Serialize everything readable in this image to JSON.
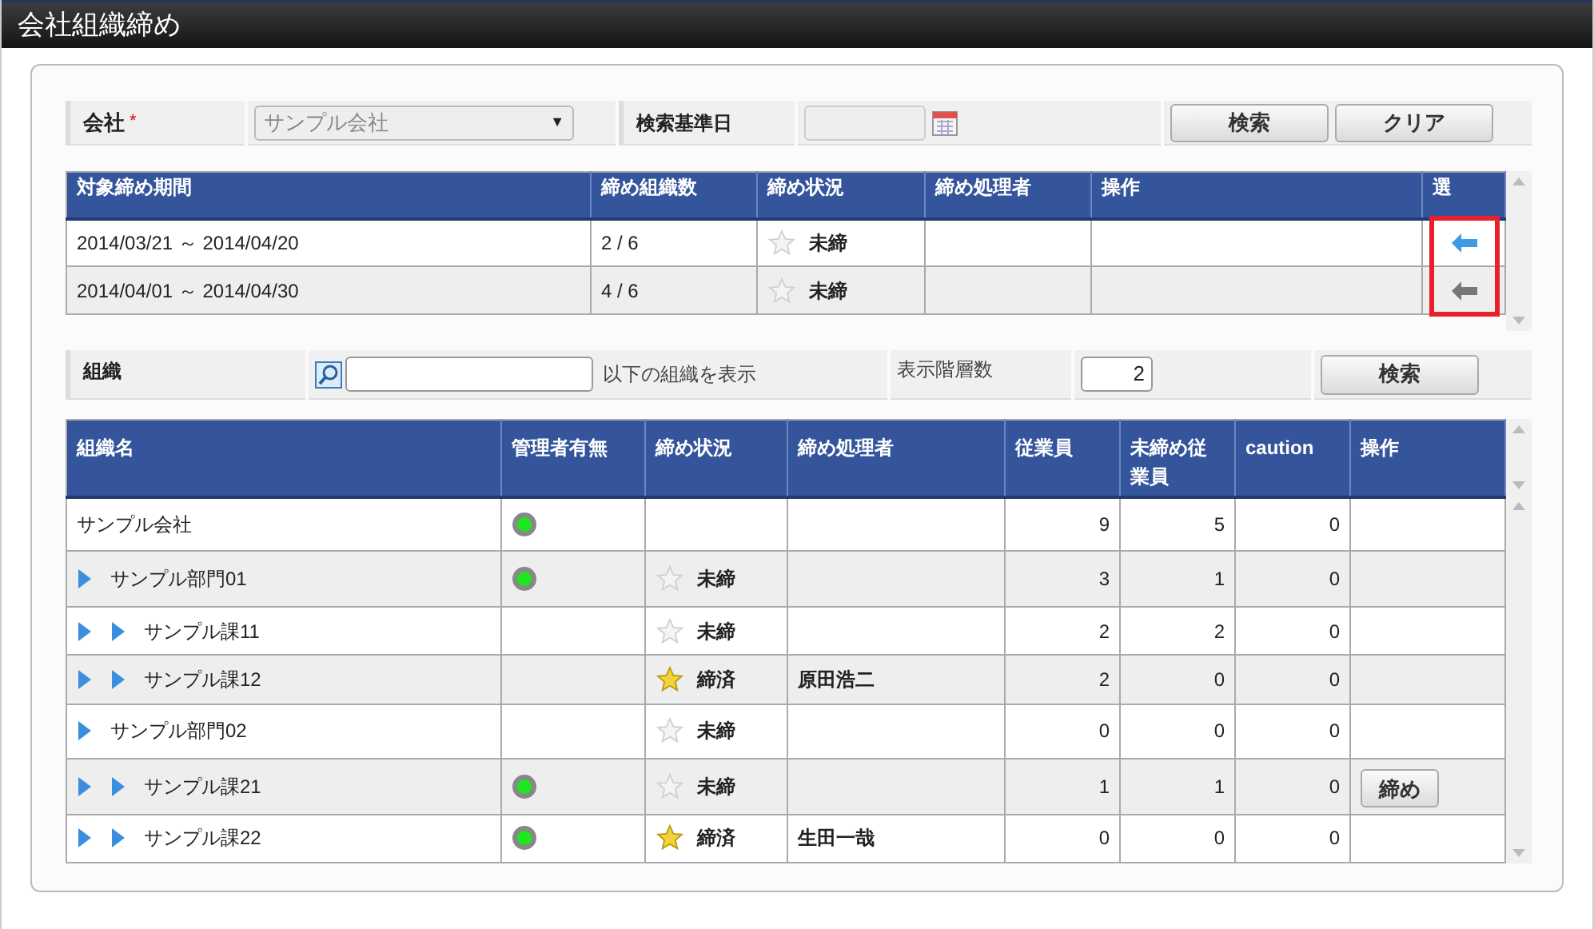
{
  "window": {
    "title": "会社組織締め"
  },
  "filter": {
    "company_label": "会社",
    "required_mark": "*",
    "company_value": "サンプル会社",
    "dropdown_glyph": "▼",
    "date_label": "検索基準日",
    "buttons": [
      "検索",
      "クリア"
    ]
  },
  "periods": {
    "columns": [
      "対象締め期間",
      "締め組織数",
      "締め状況",
      "締め処理者",
      "操作",
      "選"
    ],
    "rows": [
      {
        "period": "2014/03/21 ～ 2014/04/20",
        "count": "2 / 6",
        "closed": false,
        "status": "未締",
        "selected": true
      },
      {
        "period": "2014/04/01 ～ 2014/04/30",
        "count": "4 / 6",
        "closed": false,
        "status": "未締",
        "selected": false
      }
    ]
  },
  "org_filter": {
    "label": "組織",
    "suffix": "以下の組織を表示",
    "levels_label": "表示階層数",
    "levels_value": "2",
    "button": "検索"
  },
  "orgs": {
    "columns": [
      "組織名",
      "管理者有無",
      "締め状況",
      "締め処理者",
      "従業員",
      "未締め従業員",
      "caution",
      "操作"
    ],
    "rows": [
      {
        "name": "サンプル会社",
        "manager": true,
        "employees": "9",
        "unclosed": "5",
        "caution": "0",
        "children": [
          {
            "name": "サンプル部門01",
            "manager": true,
            "closed": false,
            "status": "未締",
            "employees": "3",
            "unclosed": "1",
            "caution": "0",
            "children": [
              {
                "name": "サンプル課11",
                "manager": false,
                "closed": false,
                "status": "未締",
                "employees": "2",
                "unclosed": "2",
                "caution": "0"
              },
              {
                "name": "サンプル課12",
                "manager": false,
                "closed": true,
                "status": "締済",
                "closer": "原田浩二",
                "employees": "2",
                "unclosed": "0",
                "caution": "0"
              }
            ]
          },
          {
            "name": "サンプル部門02",
            "manager": false,
            "closed": false,
            "status": "未締",
            "employees": "0",
            "unclosed": "0",
            "caution": "0",
            "children": [
              {
                "name": "サンプル課21",
                "manager": true,
                "closed": false,
                "status": "未締",
                "employees": "1",
                "unclosed": "1",
                "caution": "0",
                "action": "締め"
              },
              {
                "name": "サンプル課22",
                "manager": true,
                "closed": true,
                "status": "締済",
                "closer": "生田一哉",
                "employees": "0",
                "unclosed": "0",
                "caution": "0"
              }
            ]
          }
        ]
      }
    ]
  }
}
